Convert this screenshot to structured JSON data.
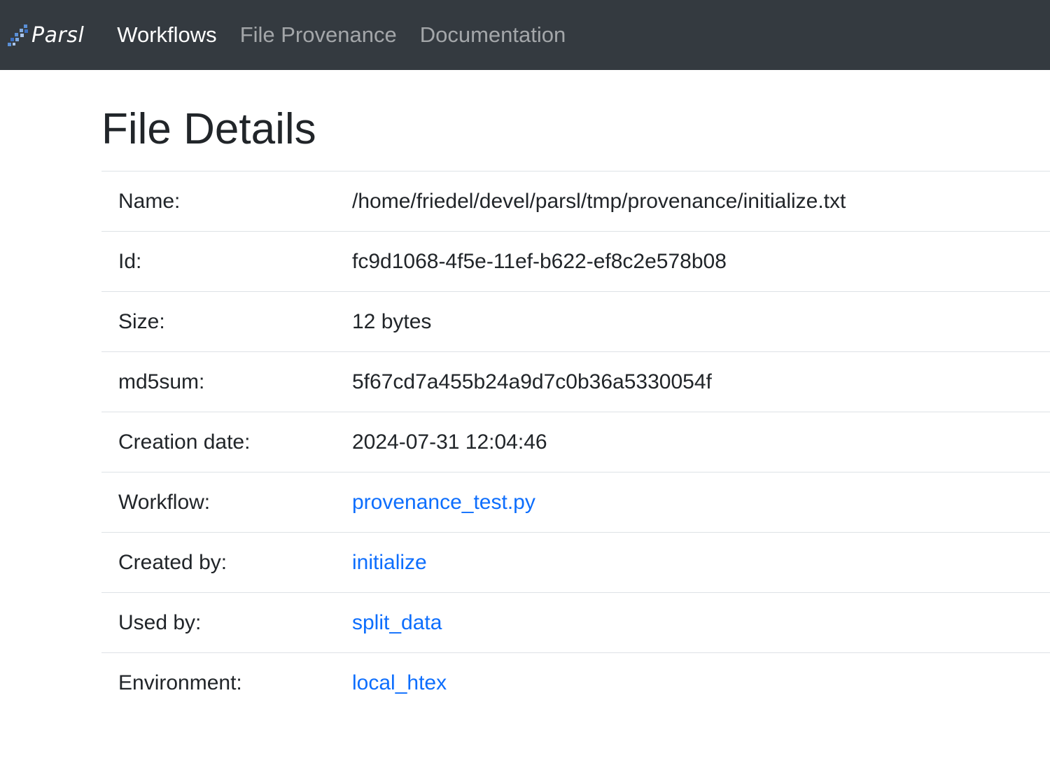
{
  "navbar": {
    "brand": "Parsl",
    "links": [
      {
        "label": "Workflows",
        "active": true
      },
      {
        "label": "File Provenance",
        "active": false
      },
      {
        "label": "Documentation",
        "active": false
      }
    ]
  },
  "page": {
    "title": "File Details"
  },
  "details": {
    "name": {
      "label": "Name:",
      "value": "/home/friedel/devel/parsl/tmp/provenance/initialize.txt"
    },
    "id": {
      "label": "Id:",
      "value": "fc9d1068-4f5e-11ef-b622-ef8c2e578b08"
    },
    "size": {
      "label": "Size:",
      "value": "12 bytes"
    },
    "md5sum": {
      "label": "md5sum:",
      "value": "5f67cd7a455b24a9d7c0b36a5330054f"
    },
    "creation_date": {
      "label": "Creation date:",
      "value": "2024-07-31 12:04:46"
    },
    "workflow": {
      "label": "Workflow:",
      "value": "provenance_test.py"
    },
    "created_by": {
      "label": "Created by:",
      "value": "initialize"
    },
    "used_by": {
      "label": "Used by:",
      "value": "split_data"
    },
    "environment": {
      "label": "Environment:",
      "value": "local_htex"
    }
  },
  "colors": {
    "navbar_bg": "#343a40",
    "link": "#0d6efd",
    "text": "#212529"
  }
}
